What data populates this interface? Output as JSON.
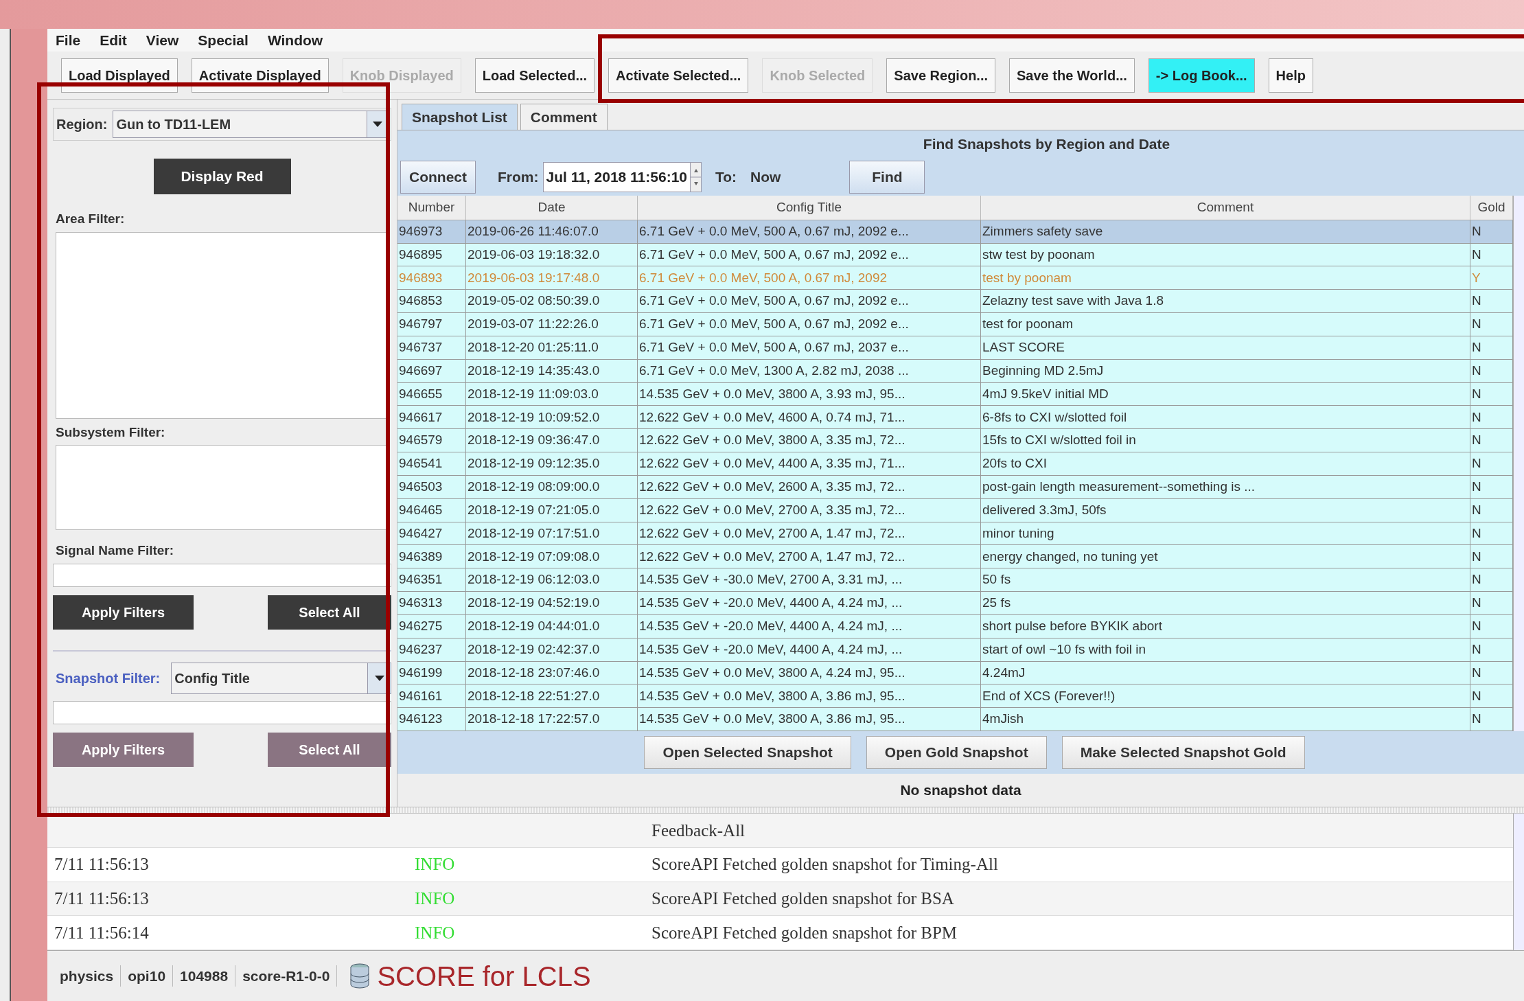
{
  "menu": [
    "File",
    "Edit",
    "View",
    "Special",
    "Window"
  ],
  "toolbar": [
    {
      "label": "Load Displayed",
      "disabled": false,
      "highlighted": false
    },
    {
      "label": "Activate Displayed",
      "disabled": false,
      "highlighted": false
    },
    {
      "label": "Knob Displayed",
      "disabled": true,
      "highlighted": false
    },
    {
      "label": "Load Selected...",
      "disabled": false,
      "highlighted": false
    },
    {
      "label": "Activate Selected...",
      "disabled": false,
      "highlighted": false
    },
    {
      "label": "Knob Selected",
      "disabled": true,
      "highlighted": false
    },
    {
      "label": "Save Region...",
      "disabled": false,
      "highlighted": false
    },
    {
      "label": "Save the World...",
      "disabled": false,
      "highlighted": false
    },
    {
      "label": "-> Log Book...",
      "disabled": false,
      "highlighted": true
    },
    {
      "label": "Help",
      "disabled": false,
      "highlighted": false
    }
  ],
  "left_panel": {
    "region": {
      "label": "Region:",
      "value": "Gun to TD11-LEM"
    },
    "display_button": "Display Red",
    "area_filter_label": "Area Filter:",
    "subsystem_filter_label": "Subsystem Filter:",
    "signal_name_filter_label": "Signal Name Filter:",
    "filter_buttons": [
      {
        "label": "Apply Filters",
        "disabled": false
      },
      {
        "label": "Select All",
        "disabled": false
      }
    ],
    "snapshot_filter": {
      "label": "Snapshot Filter:",
      "value": "Config Title"
    },
    "snapshot_filter_buttons": [
      {
        "label": "Apply Filters",
        "disabled": true
      },
      {
        "label": "Select All",
        "disabled": true
      }
    ]
  },
  "tabs": [
    {
      "label": "Snapshot List",
      "selected": true
    },
    {
      "label": "Comment",
      "selected": false
    }
  ],
  "find_panel": {
    "title": "Find Snapshots by Region and Date",
    "connect_button": "Connect",
    "from_label": "From:",
    "from_value": "Jul 11, 2018 11:56:10",
    "to_label": "To:",
    "to_value": "Now",
    "find_button": "Find"
  },
  "table": {
    "columns": [
      "Number",
      "Date",
      "Config Title",
      "Comment",
      "Gold"
    ],
    "rows": [
      {
        "cells": [
          "946973",
          "2019-06-26 11:46:07.0",
          "6.71 GeV + 0.0 MeV, 500 A, 0.67 mJ, 2092 e...",
          "Zimmers safety save",
          "N"
        ],
        "selected": true,
        "highlighted": false
      },
      {
        "cells": [
          "946895",
          "2019-06-03 19:18:32.0",
          "6.71 GeV + 0.0 MeV, 500 A, 0.67 mJ, 2092 e...",
          "stw test by poonam",
          "N"
        ],
        "selected": false,
        "highlighted": false
      },
      {
        "cells": [
          "946893",
          "2019-06-03 19:17:48.0",
          "6.71 GeV + 0.0 MeV, 500 A, 0.67 mJ, 2092",
          "test by poonam",
          "Y"
        ],
        "selected": false,
        "highlighted": true
      },
      {
        "cells": [
          "946853",
          "2019-05-02 08:50:39.0",
          "6.71 GeV + 0.0 MeV, 500 A, 0.67 mJ, 2092 e...",
          "Zelazny test save with Java 1.8",
          "N"
        ],
        "selected": false,
        "highlighted": false
      },
      {
        "cells": [
          "946797",
          "2019-03-07 11:22:26.0",
          "6.71 GeV + 0.0 MeV, 500 A, 0.67 mJ, 2092 e...",
          "test for poonam",
          "N"
        ],
        "selected": false,
        "highlighted": false
      },
      {
        "cells": [
          "946737",
          "2018-12-20 01:25:11.0",
          "6.71 GeV + 0.0 MeV, 500 A, 0.67 mJ, 2037 e...",
          "LAST SCORE",
          "N"
        ],
        "selected": false,
        "highlighted": false
      },
      {
        "cells": [
          "946697",
          "2018-12-19 14:35:43.0",
          "6.71 GeV + 0.0 MeV, 1300 A, 2.82 mJ, 2038 ...",
          "Beginning MD 2.5mJ",
          "N"
        ],
        "selected": false,
        "highlighted": false
      },
      {
        "cells": [
          "946655",
          "2018-12-19 11:09:03.0",
          "14.535 GeV + 0.0 MeV, 3800 A, 3.93 mJ, 95...",
          "4mJ 9.5keV initial MD",
          "N"
        ],
        "selected": false,
        "highlighted": false
      },
      {
        "cells": [
          "946617",
          "2018-12-19 10:09:52.0",
          "12.622 GeV + 0.0 MeV, 4600 A, 0.74 mJ, 71...",
          "6-8fs to CXI w/slotted foil",
          "N"
        ],
        "selected": false,
        "highlighted": false
      },
      {
        "cells": [
          "946579",
          "2018-12-19 09:36:47.0",
          "12.622 GeV + 0.0 MeV, 3800 A, 3.35 mJ, 72...",
          "15fs to CXI w/slotted foil in",
          "N"
        ],
        "selected": false,
        "highlighted": false
      },
      {
        "cells": [
          "946541",
          "2018-12-19 09:12:35.0",
          "12.622 GeV + 0.0 MeV, 4400 A, 3.35 mJ, 71...",
          "20fs to CXI",
          "N"
        ],
        "selected": false,
        "highlighted": false
      },
      {
        "cells": [
          "946503",
          "2018-12-19 08:09:00.0",
          "12.622 GeV + 0.0 MeV, 2600 A, 3.35 mJ, 72...",
          "post-gain length measurement--something is ...",
          "N"
        ],
        "selected": false,
        "highlighted": false
      },
      {
        "cells": [
          "946465",
          "2018-12-19 07:21:05.0",
          "12.622 GeV + 0.0 MeV, 2700 A, 3.35 mJ, 72...",
          "delivered 3.3mJ, 50fs",
          "N"
        ],
        "selected": false,
        "highlighted": false
      },
      {
        "cells": [
          "946427",
          "2018-12-19 07:17:51.0",
          "12.622 GeV + 0.0 MeV, 2700 A, 1.47 mJ, 72...",
          "minor tuning",
          "N"
        ],
        "selected": false,
        "highlighted": false
      },
      {
        "cells": [
          "946389",
          "2018-12-19 07:09:08.0",
          "12.622 GeV + 0.0 MeV, 2700 A, 1.47 mJ, 72...",
          "energy changed, no tuning yet",
          "N"
        ],
        "selected": false,
        "highlighted": false
      },
      {
        "cells": [
          "946351",
          "2018-12-19 06:12:03.0",
          "14.535 GeV + -30.0 MeV, 2700 A, 3.31 mJ, ...",
          "50 fs",
          "N"
        ],
        "selected": false,
        "highlighted": false
      },
      {
        "cells": [
          "946313",
          "2018-12-19 04:52:19.0",
          "14.535 GeV + -20.0 MeV, 4400 A, 4.24 mJ, ...",
          "25 fs",
          "N"
        ],
        "selected": false,
        "highlighted": false
      },
      {
        "cells": [
          "946275",
          "2018-12-19 04:44:01.0",
          "14.535 GeV + -20.0 MeV, 4400 A, 4.24 mJ, ...",
          "short pulse before BYKIK abort",
          "N"
        ],
        "selected": false,
        "highlighted": false
      },
      {
        "cells": [
          "946237",
          "2018-12-19 02:42:37.0",
          "14.535 GeV + -20.0 MeV, 4400 A, 4.24 mJ, ...",
          "start of owl ~10 fs with foil in",
          "N"
        ],
        "selected": false,
        "highlighted": false
      },
      {
        "cells": [
          "946199",
          "2018-12-18 23:07:46.0",
          "14.535 GeV + 0.0 MeV, 3800 A, 4.24 mJ, 95...",
          "4.24mJ",
          "N"
        ],
        "selected": false,
        "highlighted": false
      },
      {
        "cells": [
          "946161",
          "2018-12-18 22:51:27.0",
          "14.535 GeV + 0.0 MeV, 3800 A, 3.86 mJ, 95...",
          "End of XCS (Forever!!)",
          "N"
        ],
        "selected": false,
        "highlighted": false
      },
      {
        "cells": [
          "946123",
          "2018-12-18 17:22:57.0",
          "14.535 GeV + 0.0 MeV, 3800 A, 3.86 mJ, 95...",
          "4mJish",
          "N"
        ],
        "selected": false,
        "highlighted": false
      }
    ]
  },
  "snapshot_buttons": [
    "Open Selected Snapshot",
    "Open Gold Snapshot",
    "Make Selected Snapshot Gold"
  ],
  "snapshot_status": "No snapshot data",
  "log": [
    {
      "message": "Feedback-All"
    },
    {
      "time": "7/11 11:56:13",
      "level": "INFO",
      "message": "ScoreAPI Fetched golden snapshot for Timing-All"
    },
    {
      "time": "7/11 11:56:13",
      "level": "INFO",
      "message": "ScoreAPI Fetched golden snapshot for BSA"
    },
    {
      "time": "7/11 11:56:14",
      "level": "INFO",
      "message": "ScoreAPI Fetched golden snapshot for BPM"
    }
  ],
  "status_bar": {
    "items": [
      "physics",
      "opi10",
      "104988",
      "score-R1-0-0"
    ],
    "app_title": "SCORE for LCLS"
  }
}
